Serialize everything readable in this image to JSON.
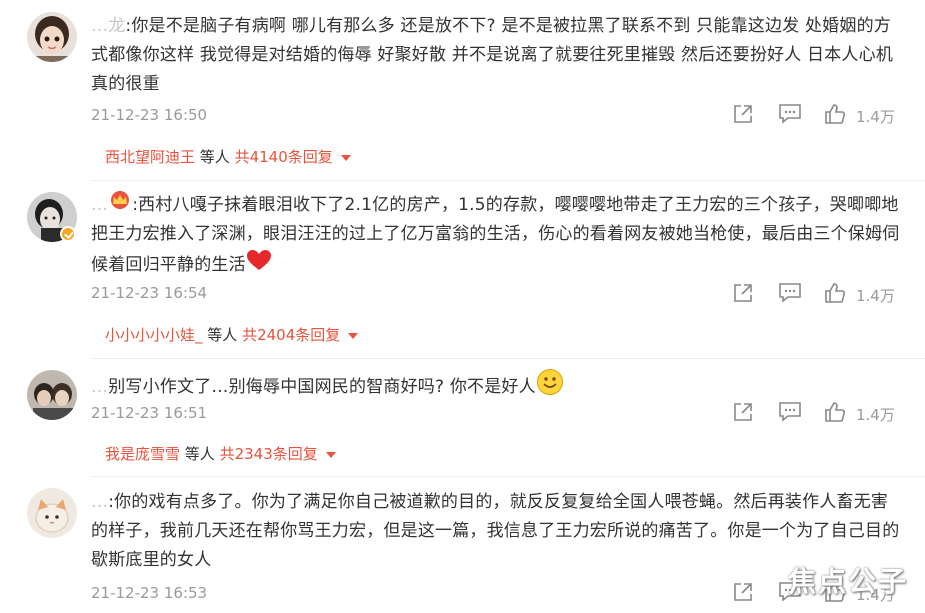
{
  "comments": [
    {
      "username": "…龙",
      "text": ":你是不是脑子有病啊 哪儿有那么多 还是放不下? 是不是被拉黑了联系不到 只能靠这边发 处婚姻的方式都像你这样 我觉得是对结婚的侮辱 好聚好散 并不是说离了就要往死里摧毁 然后还要扮好人 日本人心机真的很重",
      "time": "21-12-23 16:50",
      "likes": "1.4万",
      "reply_user": "西北望阿迪王",
      "reply_mid": " 等人 ",
      "reply_count": "共4140条回复"
    },
    {
      "username": "…",
      "text": ":西村八嘎子抹着眼泪收下了2.1亿的房产，1.5的存款，嘤嘤嘤地带走了王力宏的三个孩子，哭唧唧地把王力宏推入了深渊，眼泪汪汪的过上了亿万富翁的生活，伤心的看着网友被她当枪使，最后由三个保姆伺候着回归平静的生活",
      "time": "21-12-23 16:54",
      "likes": "1.4万",
      "reply_user": "小小小小小娃_",
      "reply_mid": " 等人 ",
      "reply_count": "共2404条回复"
    },
    {
      "username": "…",
      "text": "别写小作文了…别侮辱中国网民的智商好吗? 你不是好人",
      "time": "21-12-23 16:51",
      "likes": "1.4万",
      "reply_user": "我是庞雪雪",
      "reply_mid": " 等人 ",
      "reply_count": "共2343条回复"
    },
    {
      "username": "…",
      "text": ":你的戏有点多了。你为了满足你自己被道歉的目的，就反反复复给全国人喂苍蝇。然后再装作人畜无害的样子，我前几天还在帮你骂王力宏，但是这一篇，我信息了王力宏所说的痛苦了。你是一个为了自己目的歇斯底里的女人",
      "time": "21-12-23 16:53",
      "likes": "1.4万"
    }
  ],
  "icons": {
    "share": "share-icon",
    "comment": "comment-icon",
    "like": "thumbs-up-icon",
    "dropdown": "triangle-down-icon",
    "crown": "crown-icon",
    "heart": "heart-emoji",
    "smile": "smile-emoji",
    "verified": "verified-badge-icon"
  },
  "colors": {
    "accent": "#e8533d",
    "meta": "#9a9a9a",
    "text": "#333333",
    "verified": "#f5a623"
  },
  "watermark": "焦点公子"
}
